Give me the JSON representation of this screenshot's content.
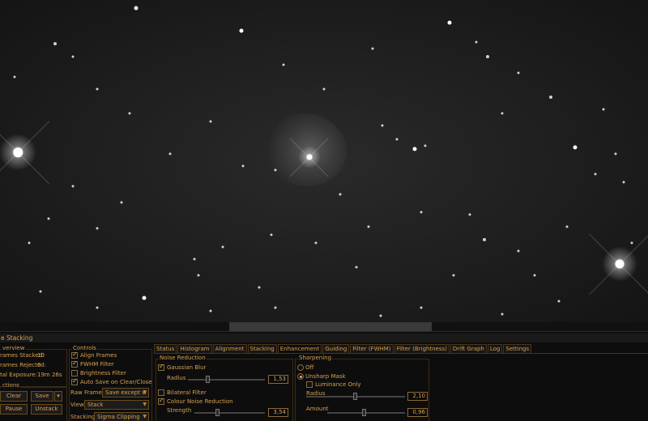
{
  "panel": {
    "title": "e Stacking"
  },
  "overview": {
    "legend": "verview",
    "frames_stacked_label": "rames Stacked:",
    "frames_stacked_value": "10",
    "frames_rejected_label": "rames Rejected:",
    "frames_rejected_value": "0",
    "total_exposure_label": "tal Exposure:",
    "total_exposure_value": "19m 26s"
  },
  "actions": {
    "legend": "ctions",
    "clear": "Clear",
    "save": "Save",
    "pause": "Pause",
    "unstack": "Unstack"
  },
  "controls": {
    "legend": "Controls",
    "align_frames": "Align Frames",
    "fwhm_filter": "FWHM Filter",
    "brightness_filter": "Brightness Filter",
    "auto_save": "Auto Save on Clear/Close",
    "raw_frames_label": "Raw Frames",
    "raw_frames_value": "Save except w",
    "view_label": "View",
    "view_value": "Stack",
    "stacking_label": "Stacking",
    "stacking_value": "Sigma Clipping"
  },
  "tabs": [
    "Status",
    "Histogram",
    "Alignment",
    "Stacking",
    "Enhancement",
    "Guiding",
    "Filter (FWHM)",
    "Filter (Brightness)",
    "Drift Graph",
    "Log",
    "Settings"
  ],
  "noise_reduction": {
    "legend": "Noise Reduction",
    "gaussian_blur": "Gaussian Blur",
    "radius_label": "Radius",
    "radius_value": "1,53",
    "bilateral_filter": "Bilateral Filter",
    "colour_noise_reduction": "Colour Noise Reduction",
    "strength_label": "Strength",
    "strength_value": "3,54"
  },
  "sharpening": {
    "legend": "Sharpening",
    "off": "Off",
    "unsharp_mask": "Unsharp Mask",
    "luminance_only": "Luminance Only",
    "radius_label": "Radius",
    "radius_value": "2,10",
    "amount_label": "Amount",
    "amount_value": "0,96"
  }
}
